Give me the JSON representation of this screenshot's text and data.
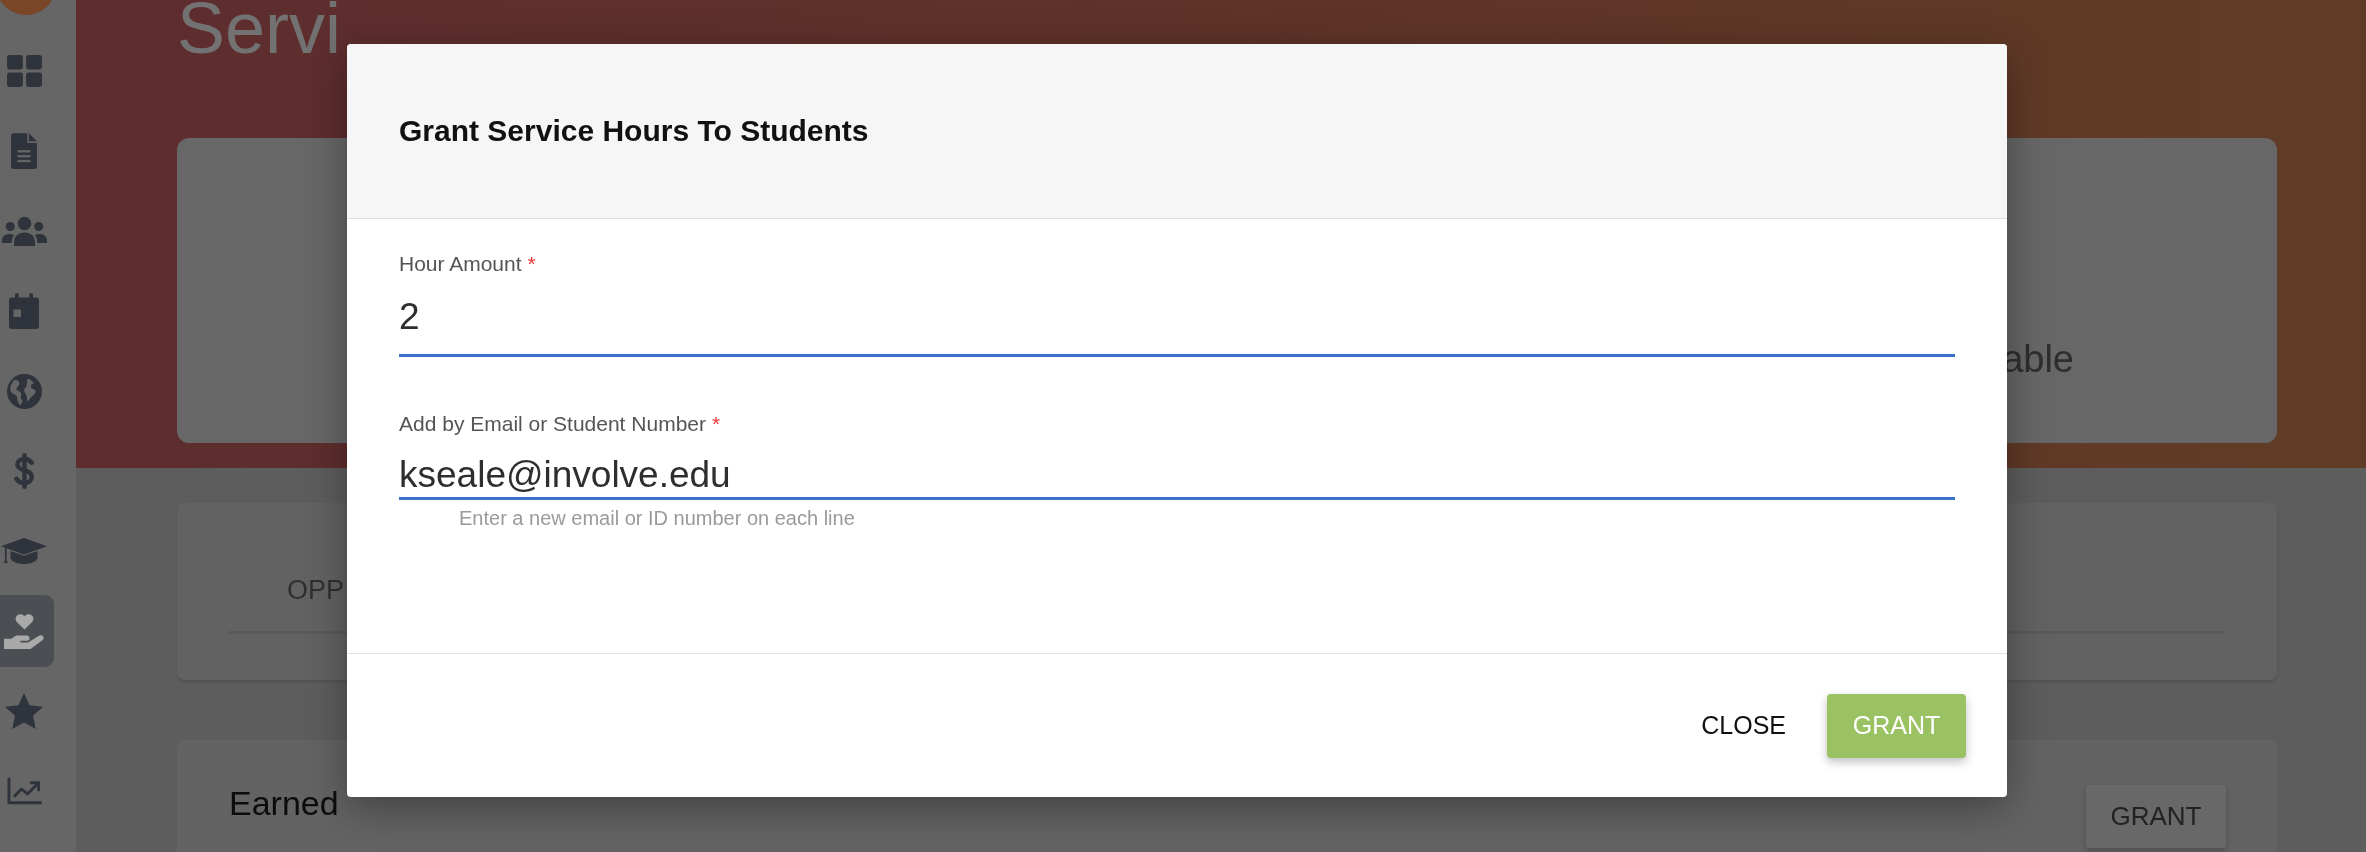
{
  "sidebar": {
    "items": [
      {
        "selected": false
      },
      {
        "selected": false
      },
      {
        "selected": false
      },
      {
        "selected": false
      },
      {
        "selected": false
      },
      {
        "selected": false
      },
      {
        "selected": false
      },
      {
        "selected": true
      },
      {
        "selected": false
      },
      {
        "selected": false
      }
    ]
  },
  "page": {
    "title": "Servi",
    "summary_card": {
      "text": "able"
    },
    "tabs_card": {
      "tabs": [
        {
          "label": "OPP"
        }
      ]
    },
    "earned_card": {
      "title": "Earned",
      "button": "GRANT"
    }
  },
  "dialog": {
    "title": "Grant Service Hours To Students",
    "fields": [
      {
        "kind": "input",
        "label": "Hour Amount",
        "required_mark": "*",
        "value": "2"
      },
      {
        "kind": "textarea",
        "label": "Add by Email or Student Number",
        "required_mark": "*",
        "value": "kseale@involve.edu",
        "hint": "Enter a new email or ID number on each line"
      }
    ],
    "buttons": [
      {
        "kind": "flat",
        "label": "CLOSE"
      },
      {
        "kind": "raised",
        "label": "GRANT"
      }
    ]
  }
}
